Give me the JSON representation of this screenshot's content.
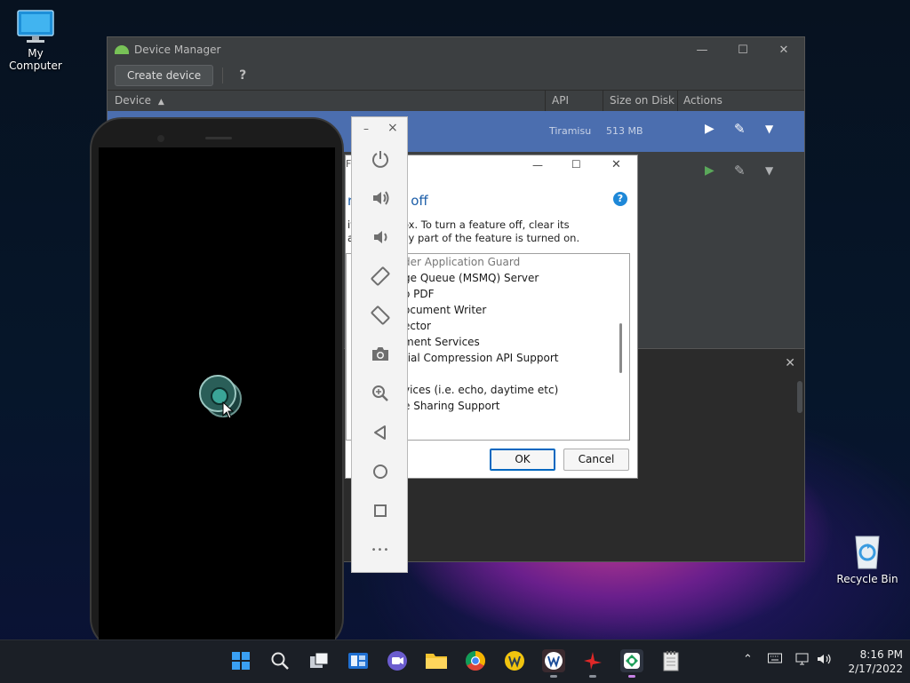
{
  "desktop": {
    "my_computer_label": "My Computer",
    "recycle_bin_label": "Recycle Bin"
  },
  "device_manager": {
    "title": "Device Manager",
    "create_device_label": "Create device",
    "help_label": "?",
    "columns": {
      "device": "Device",
      "api": "API",
      "size": "Size on Disk",
      "actions": "Actions"
    },
    "rows": [
      {
        "api": "Tiramisu",
        "size": "513 MB"
      }
    ],
    "accent_color": "#4b6eaf",
    "run_color": "#5aa85a"
  },
  "emulator_toolbar": {
    "minimize_label": "–",
    "close_label": "×",
    "more_label": "•••"
  },
  "windows_features": {
    "title_fragment": "Fe",
    "heading": "res on or off",
    "desc_line1": "its check box. To turn a feature off, clear its",
    "desc_line2": "ans that only part of the feature is turned on.",
    "items": [
      "der Application Guard",
      "ge Queue (MSMQ) Server",
      "o PDF",
      "ocument Writer",
      "ector",
      "ment Services",
      "tial Compression API Support",
      "",
      "vices (i.e. echo, daytime etc)",
      "e Sharing Support"
    ],
    "ok_label": "OK",
    "cancel_label": "Cancel"
  },
  "taskbar": {
    "time": "8:16 PM",
    "date": "2/17/2022"
  }
}
